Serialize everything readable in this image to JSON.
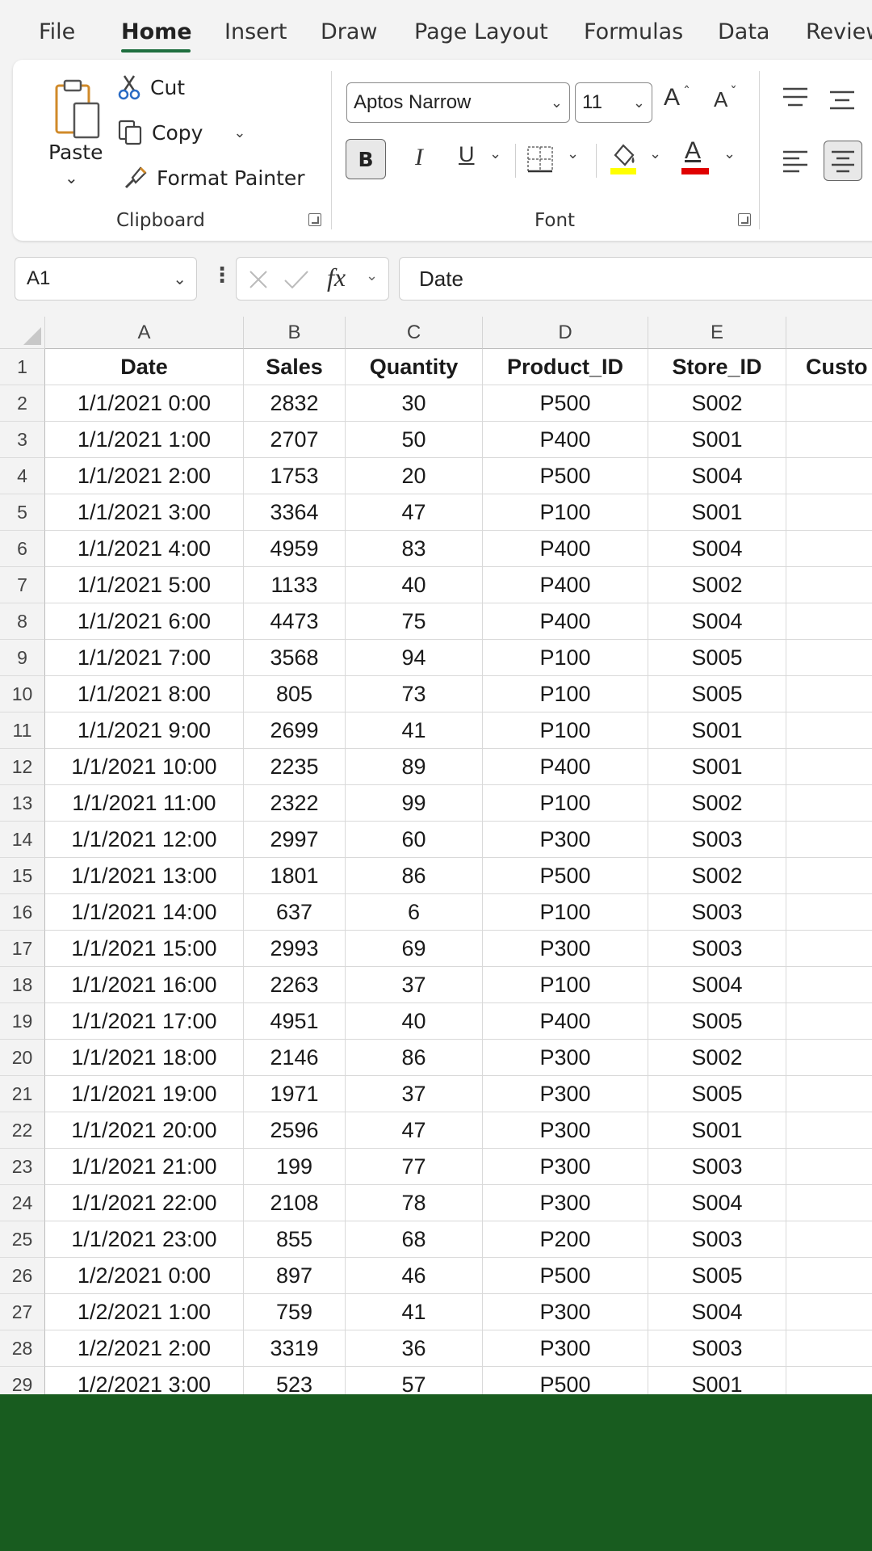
{
  "menu": {
    "tabs": [
      "File",
      "Home",
      "Insert",
      "Draw",
      "Page Layout",
      "Formulas",
      "Data",
      "Review"
    ],
    "active": "Home"
  },
  "ribbon": {
    "clipboard": {
      "paste_label": "Paste",
      "cut_label": "Cut",
      "copy_label": "Copy",
      "format_painter_label": "Format Painter",
      "group_label": "Clipboard"
    },
    "font": {
      "font_name": "Aptos Narrow",
      "font_size": "11",
      "group_label": "Font",
      "bold_label": "B",
      "italic_label": "I",
      "underline_label": "U",
      "font_color_label": "A",
      "grow_label": "A",
      "shrink_label": "A",
      "highlight_color": "#ffff00",
      "font_color": "#e00000"
    }
  },
  "formula_bar": {
    "name_box": "A1",
    "fx_label": "fx",
    "content": "Date"
  },
  "grid": {
    "columns": [
      "A",
      "B",
      "C",
      "D",
      "E",
      ""
    ],
    "headers": [
      "Date",
      "Sales",
      "Quantity",
      "Product_ID",
      "Store_ID",
      "Custo"
    ],
    "rows": [
      [
        "1/1/2021 0:00",
        "2832",
        "30",
        "P500",
        "S002"
      ],
      [
        "1/1/2021 1:00",
        "2707",
        "50",
        "P400",
        "S001"
      ],
      [
        "1/1/2021 2:00",
        "1753",
        "20",
        "P500",
        "S004"
      ],
      [
        "1/1/2021 3:00",
        "3364",
        "47",
        "P100",
        "S001"
      ],
      [
        "1/1/2021 4:00",
        "4959",
        "83",
        "P400",
        "S004"
      ],
      [
        "1/1/2021 5:00",
        "1133",
        "40",
        "P400",
        "S002"
      ],
      [
        "1/1/2021 6:00",
        "4473",
        "75",
        "P400",
        "S004"
      ],
      [
        "1/1/2021 7:00",
        "3568",
        "94",
        "P100",
        "S005"
      ],
      [
        "1/1/2021 8:00",
        "805",
        "73",
        "P100",
        "S005"
      ],
      [
        "1/1/2021 9:00",
        "2699",
        "41",
        "P100",
        "S001"
      ],
      [
        "1/1/2021 10:00",
        "2235",
        "89",
        "P400",
        "S001"
      ],
      [
        "1/1/2021 11:00",
        "2322",
        "99",
        "P100",
        "S002"
      ],
      [
        "1/1/2021 12:00",
        "2997",
        "60",
        "P300",
        "S003"
      ],
      [
        "1/1/2021 13:00",
        "1801",
        "86",
        "P500",
        "S002"
      ],
      [
        "1/1/2021 14:00",
        "637",
        "6",
        "P100",
        "S003"
      ],
      [
        "1/1/2021 15:00",
        "2993",
        "69",
        "P300",
        "S003"
      ],
      [
        "1/1/2021 16:00",
        "2263",
        "37",
        "P100",
        "S004"
      ],
      [
        "1/1/2021 17:00",
        "4951",
        "40",
        "P400",
        "S005"
      ],
      [
        "1/1/2021 18:00",
        "2146",
        "86",
        "P300",
        "S002"
      ],
      [
        "1/1/2021 19:00",
        "1971",
        "37",
        "P300",
        "S005"
      ],
      [
        "1/1/2021 20:00",
        "2596",
        "47",
        "P300",
        "S001"
      ],
      [
        "1/1/2021 21:00",
        "199",
        "77",
        "P300",
        "S003"
      ],
      [
        "1/1/2021 22:00",
        "2108",
        "78",
        "P300",
        "S004"
      ],
      [
        "1/1/2021 23:00",
        "855",
        "68",
        "P200",
        "S003"
      ],
      [
        "1/2/2021 0:00",
        "897",
        "46",
        "P500",
        "S005"
      ],
      [
        "1/2/2021 1:00",
        "759",
        "41",
        "P300",
        "S004"
      ],
      [
        "1/2/2021 2:00",
        "3319",
        "36",
        "P300",
        "S003"
      ],
      [
        "1/2/2021 3:00",
        "523",
        "57",
        "P500",
        "S001"
      ]
    ]
  },
  "colors": {
    "accent": "#1e6e3e",
    "bottom_band": "#185c1f"
  }
}
